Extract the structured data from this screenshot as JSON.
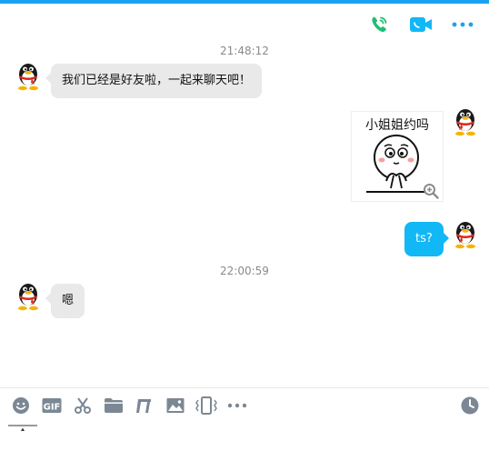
{
  "header": {
    "icons": [
      "voice-call-icon",
      "video-call-icon",
      "more-icon"
    ],
    "colors": {
      "call_green": "#1dbf73",
      "video_blue": "#12b7f5",
      "more_blue": "#1aa3f0",
      "top_strip": "#1aa3f0"
    }
  },
  "messages": {
    "time1": "21:48:12",
    "msg1": "我们已经是好友啦，一起来聊天吧！",
    "sticker_caption": "小姐姐约吗",
    "msg3": "ts?",
    "time2": "22:00:59",
    "msg4": "嗯"
  },
  "bubble_colors": {
    "incoming": "#e9e9e9",
    "outgoing": "#12b7f5"
  },
  "toolbar": {
    "gif_label": "GIF",
    "icons": [
      "emoji-icon",
      "gif-icon",
      "scissors-icon",
      "folder-icon",
      "music-note-icon",
      "image-icon",
      "shake-icon",
      "more-icon",
      "history-clock-icon"
    ]
  }
}
